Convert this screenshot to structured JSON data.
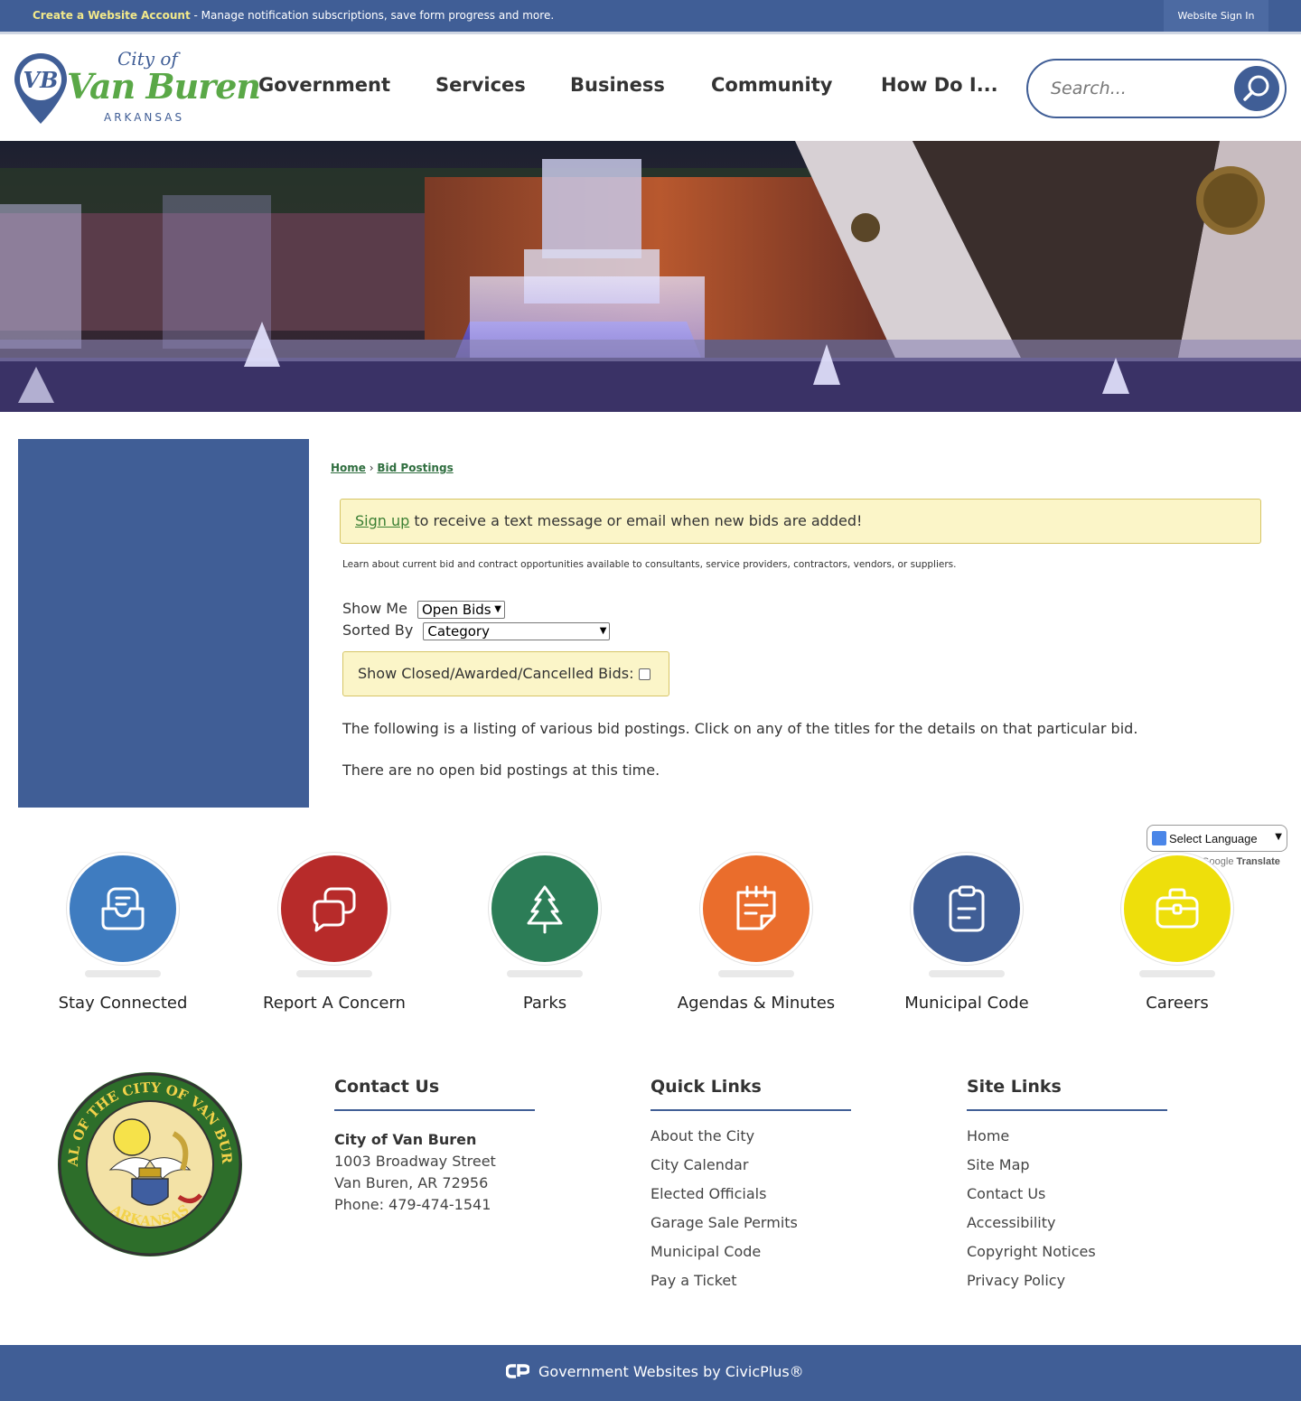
{
  "topbar": {
    "create_label": "Create a Website Account",
    "create_desc": " - Manage notification subscriptions, save form progress and more.",
    "signin_label": "Website Sign In"
  },
  "logo": {
    "city_of": "City of",
    "name": "Van Buren",
    "state": "ARKANSAS",
    "monogram": "VB"
  },
  "nav": {
    "items": [
      "Government",
      "Services",
      "Business",
      "Community",
      "How Do I..."
    ]
  },
  "search": {
    "placeholder": "Search..."
  },
  "breadcrumb": {
    "home": "Home",
    "separator": " › ",
    "current": "Bid Postings"
  },
  "notice": {
    "link": "Sign up",
    "text": " to receive a text message or email when new bids are added!"
  },
  "learn_text": "Learn about current bid and contract opportunities available to consultants, service providers, contractors, vendors, or suppliers.",
  "filters": {
    "show_me_label": "Show Me",
    "show_me_value": "Open Bids",
    "sorted_by_label": "Sorted By",
    "sorted_by_value": "Category",
    "closed_label": "Show Closed/Awarded/Cancelled Bids:"
  },
  "intro_text": "The following is a listing of various bid postings. Click on any of the titles for the details on that particular bid.",
  "none_text": "There are no open bid postings at this time.",
  "translate": {
    "select_label": "Select Language",
    "powered_prefix": "Google",
    "powered_suffix": "Translate"
  },
  "quick_links": [
    {
      "label": "Stay Connected",
      "icon": "message-inbox-icon",
      "color": "#3f7cc0"
    },
    {
      "label": "Report A Concern",
      "icon": "chat-bubbles-icon",
      "color": "#b72b2a"
    },
    {
      "label": "Parks",
      "icon": "tree-icon",
      "color": "#2c7d57"
    },
    {
      "label": "Agendas & Minutes",
      "icon": "notepad-icon",
      "color": "#ea6d2c"
    },
    {
      "label": "Municipal Code",
      "icon": "clipboard-icon",
      "color": "#405e96"
    },
    {
      "label": "Careers",
      "icon": "briefcase-icon",
      "color": "#eedf0b"
    }
  ],
  "footer": {
    "contact": {
      "title": "Contact Us",
      "org": "City of Van Buren",
      "street": "1003 Broadway Street",
      "city": "Van Buren, AR 72956",
      "phone": "Phone: 479-474-1541"
    },
    "quick": {
      "title": "Quick Links",
      "items": [
        "About the City",
        "City Calendar",
        "Elected Officials",
        "Garage Sale Permits",
        "Municipal Code",
        "Pay a Ticket"
      ]
    },
    "site": {
      "title": "Site Links",
      "items": [
        "Home",
        "Site Map",
        "Contact Us",
        "Accessibility",
        "Copyright Notices",
        "Privacy Policy"
      ]
    },
    "credit": "Government Websites by CivicPlus®"
  },
  "seal": {
    "text_top": "SEAL OF THE CITY OF VAN BUREN",
    "text_bottom": "ARKANSAS"
  },
  "colors": {
    "brand_blue": "#405e96",
    "brand_green": "#5aa847",
    "notice_bg": "#fbf5c8"
  }
}
